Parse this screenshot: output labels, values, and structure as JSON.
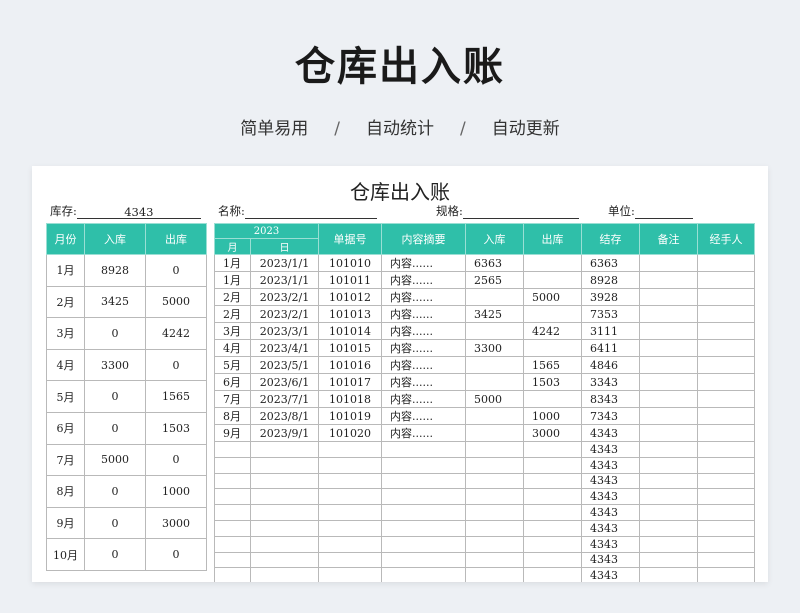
{
  "banner": {
    "title": "仓库出入账",
    "tags": [
      "简单易用",
      "自动统计",
      "自动更新"
    ],
    "separator": "/"
  },
  "sheet": {
    "title": "仓库出入账",
    "stock_label": "库存:",
    "stock_value": "4343",
    "name_label": "名称:",
    "spec_label": "规格:",
    "unit_label": "单位:"
  },
  "summary": {
    "headers": [
      "月份",
      "入库",
      "出库"
    ],
    "rows": [
      [
        "1月",
        "8928",
        "0"
      ],
      [
        "2月",
        "3425",
        "5000"
      ],
      [
        "3月",
        "0",
        "4242"
      ],
      [
        "4月",
        "3300",
        "0"
      ],
      [
        "5月",
        "0",
        "1565"
      ],
      [
        "6月",
        "0",
        "1503"
      ],
      [
        "7月",
        "5000",
        "0"
      ],
      [
        "8月",
        "0",
        "1000"
      ],
      [
        "9月",
        "0",
        "3000"
      ],
      [
        "10月",
        "0",
        "0"
      ]
    ]
  },
  "ledger": {
    "year": "2023",
    "month_label": "月",
    "day_label": "日",
    "headers": [
      "单据号",
      "内容摘要",
      "入库",
      "出库",
      "结存",
      "备注",
      "经手人"
    ],
    "rows": [
      [
        "1月",
        "2023/1/1",
        "101010",
        "内容......",
        "6363",
        "",
        "6363",
        "",
        ""
      ],
      [
        "1月",
        "2023/1/1",
        "101011",
        "内容......",
        "2565",
        "",
        "8928",
        "",
        ""
      ],
      [
        "2月",
        "2023/2/1",
        "101012",
        "内容......",
        "",
        "5000",
        "3928",
        "",
        ""
      ],
      [
        "2月",
        "2023/2/1",
        "101013",
        "内容......",
        "3425",
        "",
        "7353",
        "",
        ""
      ],
      [
        "3月",
        "2023/3/1",
        "101014",
        "内容......",
        "",
        "4242",
        "3111",
        "",
        ""
      ],
      [
        "4月",
        "2023/4/1",
        "101015",
        "内容......",
        "3300",
        "",
        "6411",
        "",
        ""
      ],
      [
        "5月",
        "2023/5/1",
        "101016",
        "内容......",
        "",
        "1565",
        "4846",
        "",
        ""
      ],
      [
        "6月",
        "2023/6/1",
        "101017",
        "内容......",
        "",
        "1503",
        "3343",
        "",
        ""
      ],
      [
        "7月",
        "2023/7/1",
        "101018",
        "内容......",
        "5000",
        "",
        "8343",
        "",
        ""
      ],
      [
        "8月",
        "2023/8/1",
        "101019",
        "内容......",
        "",
        "1000",
        "7343",
        "",
        ""
      ],
      [
        "9月",
        "2023/9/1",
        "101020",
        "内容......",
        "",
        "3000",
        "4343",
        "",
        ""
      ],
      [
        "",
        "",
        "",
        "",
        "",
        "",
        "4343",
        "",
        ""
      ],
      [
        "",
        "",
        "",
        "",
        "",
        "",
        "4343",
        "",
        ""
      ],
      [
        "",
        "",
        "",
        "",
        "",
        "",
        "4343",
        "",
        ""
      ],
      [
        "",
        "",
        "",
        "",
        "",
        "",
        "4343",
        "",
        ""
      ],
      [
        "",
        "",
        "",
        "",
        "",
        "",
        "4343",
        "",
        ""
      ],
      [
        "",
        "",
        "",
        "",
        "",
        "",
        "4343",
        "",
        ""
      ],
      [
        "",
        "",
        "",
        "",
        "",
        "",
        "4343",
        "",
        ""
      ],
      [
        "",
        "",
        "",
        "",
        "",
        "",
        "4343",
        "",
        ""
      ],
      [
        "",
        "",
        "",
        "",
        "",
        "",
        "4343",
        "",
        ""
      ]
    ]
  }
}
